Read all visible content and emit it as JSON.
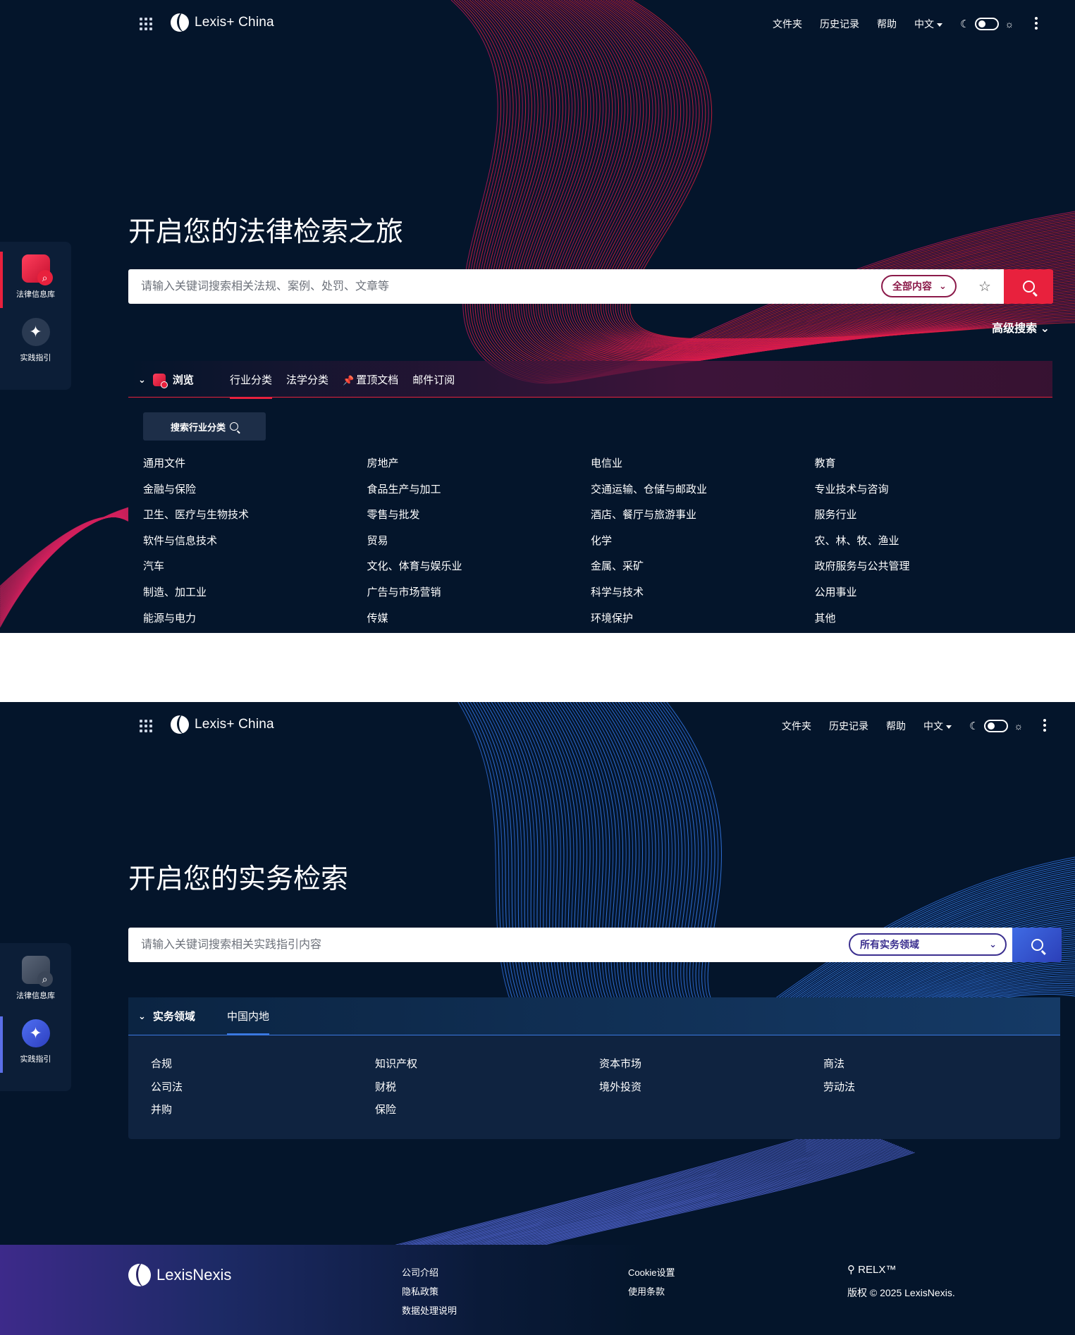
{
  "brand": {
    "logo_text": "Lexis+ China"
  },
  "nav": {
    "folders": "文件夹",
    "history": "历史记录",
    "help": "帮助",
    "language": "中文"
  },
  "siderail": {
    "legal_db": "法律信息库",
    "practice": "实践指引"
  },
  "legal_panel": {
    "hero_title": "开启您的法律检索之旅",
    "search_placeholder": "请输入关键词搜索相关法规、案例、处罚、文章等",
    "scope_label": "全部内容",
    "advanced_search": "高级搜索",
    "browse_label": "浏览",
    "tabs": [
      "行业分类",
      "法学分类",
      "置顶文档",
      "邮件订阅"
    ],
    "search_category_btn": "搜索行业分类",
    "categories": [
      "通用文件",
      "房地产",
      "电信业",
      "教育",
      "金融与保险",
      "食品生产与加工",
      "交通运输、仓储与邮政业",
      "专业技术与咨询",
      "卫生、医疗与生物技术",
      "零售与批发",
      "酒店、餐厅与旅游事业",
      "服务行业",
      "软件与信息技术",
      "贸易",
      "化学",
      "农、林、牧、渔业",
      "汽车",
      "文化、体育与娱乐业",
      "金属、采矿",
      "政府服务与公共管理",
      "制造、加工业",
      "广告与市场营销",
      "科学与技术",
      "公用事业",
      "能源与电力",
      "传媒",
      "环境保护",
      "其他"
    ]
  },
  "practice_panel": {
    "hero_title": "开启您的实务检索",
    "search_placeholder": "请输入关键词搜索相关实践指引内容",
    "scope_label": "所有实务领域",
    "section_label": "实务领域",
    "tab": "中国内地",
    "areas": [
      "合规",
      "知识产权",
      "资本市场",
      "商法",
      "公司法",
      "财税",
      "境外投资",
      "劳动法",
      "并购",
      "保险"
    ]
  },
  "footer": {
    "logo_text": "LexisNexis",
    "col1": [
      "公司介绍",
      "隐私政策",
      "数据处理说明"
    ],
    "col2": [
      "Cookie设置",
      "使用条款"
    ],
    "relx": "RELX",
    "copyright": "版权 © 2025 LexisNexis."
  },
  "colors": {
    "bg": "#04152b",
    "legal_accent": "#e8213d",
    "practice_accent": "#3a78e0"
  }
}
